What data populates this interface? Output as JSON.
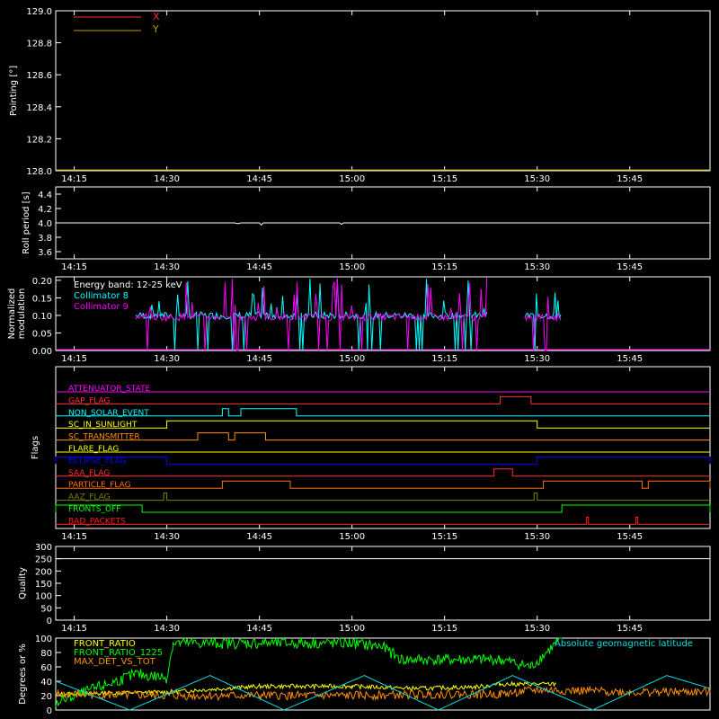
{
  "chart_data": [
    {
      "type": "line",
      "ylabel": "Pointing [°]",
      "ylim": [
        128.0,
        129.0
      ],
      "yticks": [
        "128.0",
        "128.2",
        "128.4",
        "128.6",
        "128.8",
        "129.0"
      ],
      "xticks": [
        "14:15",
        "14:30",
        "14:45",
        "15:00",
        "15:15",
        "15:30",
        "15:45"
      ],
      "xlim": [
        "14:12",
        "15:58"
      ],
      "legend": "top-left",
      "series": [
        {
          "name": "X",
          "color": "#ff3030",
          "x": [],
          "y": []
        },
        {
          "name": "Y",
          "color": "#b0a000",
          "x": [],
          "y": []
        }
      ]
    },
    {
      "type": "line",
      "ylabel": "Roll period [s]",
      "ylim": [
        3.5,
        4.5
      ],
      "yticks": [
        "3.6",
        "3.8",
        "4.0",
        "4.2",
        "4.4"
      ],
      "xticks": [
        "14:15",
        "14:30",
        "14:45",
        "15:00",
        "15:15",
        "15:30",
        "15:45"
      ],
      "series": [
        {
          "color": "#ffffff",
          "x": [
            "14:12",
            "14:41",
            "14:41.5",
            "14:42",
            "14:45",
            "14:45.3",
            "14:45.6",
            "14:58",
            "14:58.3",
            "14:58.6",
            "15:58"
          ],
          "y": [
            4.0,
            4.0,
            3.99,
            4.0,
            4.0,
            3.97,
            4.0,
            4.0,
            3.98,
            4.0,
            4.0
          ]
        }
      ]
    },
    {
      "type": "line",
      "ylabel": "Normalized modulation",
      "ylim": [
        0.0,
        0.21
      ],
      "yticks": [
        "0.00",
        "0.05",
        "0.10",
        "0.15",
        "0.20"
      ],
      "xticks": [
        "14:15",
        "14:30",
        "14:45",
        "15:00",
        "15:15",
        "15:30",
        "15:45"
      ],
      "annotation": "Energy band: 12-25 keV",
      "legend": "top-left",
      "series": [
        {
          "name": "Collimator 8",
          "color": "#00ffff",
          "level": 0.1,
          "x": [
            "14:25",
            "15:22",
            "15:28",
            "15:34"
          ],
          "y": [
            0.1,
            0.1,
            0.1,
            0.1
          ]
        },
        {
          "name": "Collimator 9",
          "color": "#ff00ff",
          "level": 0.095,
          "x": [
            "14:25",
            "15:22",
            "15:28",
            "15:34"
          ],
          "y": [
            0.095,
            0.095,
            0.095,
            0.095
          ]
        }
      ]
    },
    {
      "type": "line",
      "ylabel": "Flags",
      "xticks": [
        "14:15",
        "14:30",
        "14:45",
        "15:00",
        "15:15",
        "15:30",
        "15:45"
      ],
      "flags": [
        {
          "name": "ATTENUATOR_STATE",
          "color": "#ff00ff",
          "on": []
        },
        {
          "name": "GAP_FLAG",
          "color": "#ff3030",
          "on": [
            [
              "15:24",
              "15:29"
            ]
          ]
        },
        {
          "name": "NON_SOLAR_EVENT",
          "color": "#00ffff",
          "on": [
            [
              "14:39",
              "14:40"
            ],
            [
              "14:42",
              "14:51"
            ]
          ]
        },
        {
          "name": "SC_IN_SUNLIGHT",
          "color": "#ffff00",
          "on": [
            [
              "14:30",
              "15:30"
            ]
          ]
        },
        {
          "name": "SC_TRANSMITTER",
          "color": "#ff9000",
          "on": [
            [
              "14:35",
              "14:40"
            ],
            [
              "14:41",
              "14:46"
            ]
          ]
        },
        {
          "name": "FLARE_FLAG",
          "color": "#ffff00",
          "on": []
        },
        {
          "name": "ECLIPSE_FLAG",
          "color": "#0000ff",
          "on": [
            [
              "14:12",
              "14:30"
            ],
            [
              "15:30",
              "15:58"
            ]
          ]
        },
        {
          "name": "SAA_FLAG",
          "color": "#ff3030",
          "on": [
            [
              "15:23",
              "15:26"
            ]
          ]
        },
        {
          "name": "PARTICLE_FLAG",
          "color": "#ff7000",
          "on": [
            [
              "14:39",
              "14:50"
            ],
            [
              "15:31",
              "15:47"
            ],
            [
              "15:48",
              "15:58"
            ]
          ]
        },
        {
          "name": "AAZ_FLAG",
          "color": "#808000",
          "on": [
            [
              "14:29.5",
              "14:30"
            ],
            [
              "15:29.5",
              "15:30"
            ]
          ]
        },
        {
          "name": "FRONTS_OFF",
          "color": "#00ff00",
          "on": [
            [
              "14:12",
              "14:26"
            ],
            [
              "15:34",
              "15:58"
            ]
          ]
        },
        {
          "name": "BAD_PACKETS",
          "color": "#ff2020",
          "on": [
            [
              "15:38",
              "15:38.3"
            ],
            [
              "15:46",
              "15:46.3"
            ]
          ]
        }
      ]
    },
    {
      "type": "line",
      "ylabel": "Quality",
      "ylim": [
        0,
        300
      ],
      "yticks": [
        "0",
        "50",
        "100",
        "150",
        "200",
        "250",
        "300"
      ],
      "xticks": [
        "14:15",
        "14:30",
        "14:45",
        "15:00",
        "15:15",
        "15:30",
        "15:45"
      ],
      "series": []
    },
    {
      "type": "line",
      "ylabel": "Degrees or %",
      "ylim": [
        0,
        100
      ],
      "yticks": [
        "0",
        "20",
        "40",
        "60",
        "80",
        "100"
      ],
      "legend": "top-left",
      "series": [
        {
          "name": "FRONT_RATIO",
          "color": "#ffff00",
          "x": [
            "14:12",
            "14:30",
            "14:45",
            "15:00",
            "15:10",
            "15:20",
            "15:24",
            "15:28",
            "15:33"
          ],
          "y": [
            22,
            25,
            33,
            33,
            30,
            32,
            36,
            36,
            36
          ]
        },
        {
          "name": "FRONT_RATIO_1225",
          "color": "#00ff00",
          "x": [
            "14:12",
            "14:25",
            "14:30",
            "14:31",
            "14:45",
            "15:00",
            "15:05",
            "15:08",
            "15:20",
            "15:24",
            "15:29",
            "15:34"
          ],
          "y": [
            10,
            50,
            45,
            93,
            93,
            93,
            88,
            70,
            70,
            70,
            60,
            100
          ]
        },
        {
          "name": "MAX_DET_VS_TOT",
          "color": "#ff9000",
          "x": [
            "14:12",
            "14:30",
            "14:45",
            "15:00",
            "15:15",
            "15:24",
            "15:30",
            "15:45",
            "15:58"
          ],
          "y": [
            22,
            20,
            20,
            20,
            22,
            22,
            28,
            25,
            25
          ]
        },
        {
          "name": "Absolute geomagnetic latitude",
          "color": "#00e0e0",
          "x": [
            "14:12",
            "14:24",
            "14:37",
            "14:49",
            "15:02",
            "15:14",
            "15:26",
            "15:39",
            "15:51",
            "15:58"
          ],
          "y": [
            40,
            0,
            48,
            0,
            48,
            0,
            48,
            0,
            48,
            30
          ]
        }
      ]
    }
  ]
}
